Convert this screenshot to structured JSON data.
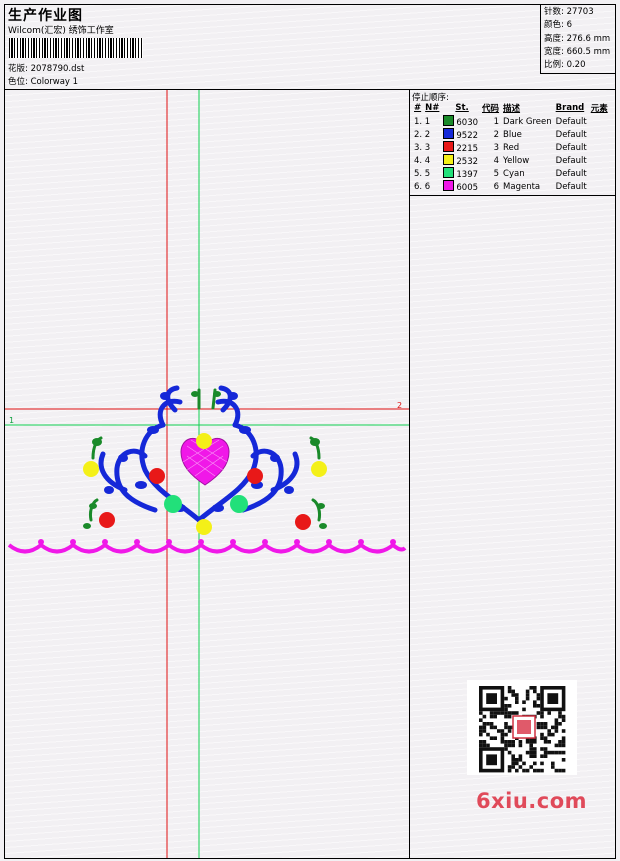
{
  "header": {
    "title": "生产作业图",
    "subtitle": "Wilcom(汇宏) 绣饰工作室",
    "design_label": "花版: 2078790.dst",
    "colorway_label": "色位: Colorway 1"
  },
  "stats": {
    "stitches": "针数: 27703",
    "colors": "颜色: 6",
    "height": "高度: 276.6 mm",
    "width": "宽度: 660.5 mm",
    "scale": "比例: 0.20"
  },
  "stop_sequence": {
    "title": "停止顺序:",
    "headers": [
      "#",
      "N#",
      "St.",
      "代码",
      "描述",
      "Brand",
      "元素"
    ],
    "rows": [
      {
        "idx": "1. 1",
        "color": "#1a8a2a",
        "code": "6030",
        "no": "1",
        "desc": "Dark Green",
        "brand": "Default"
      },
      {
        "idx": "2. 2",
        "color": "#1528d8",
        "code": "9522",
        "no": "2",
        "desc": "Blue",
        "brand": "Default"
      },
      {
        "idx": "3. 3",
        "color": "#e81818",
        "code": "2215",
        "no": "3",
        "desc": "Red",
        "brand": "Default"
      },
      {
        "idx": "4. 4",
        "color": "#f4f018",
        "code": "2532",
        "no": "4",
        "desc": "Yellow",
        "brand": "Default"
      },
      {
        "idx": "5. 5",
        "color": "#22e07a",
        "code": "1397",
        "no": "5",
        "desc": "Cyan",
        "brand": "Default"
      },
      {
        "idx": "6. 6",
        "color": "#f018e8",
        "code": "6005",
        "no": "6",
        "desc": "Magenta",
        "brand": "Default"
      }
    ]
  },
  "canvas": {
    "marker_1": "1",
    "marker_2": "2"
  },
  "watermark": "6xiu.com"
}
